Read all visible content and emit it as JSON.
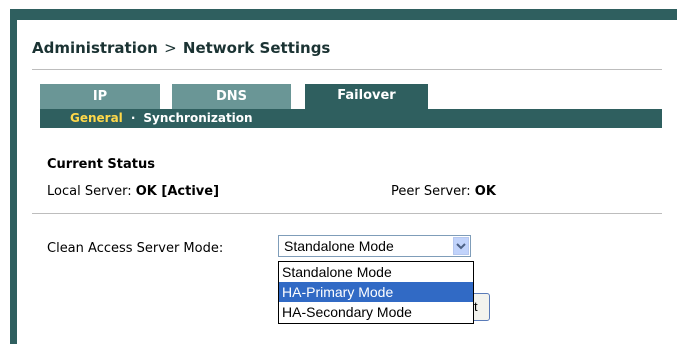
{
  "breadcrumb": {
    "section": "Administration",
    "separator": ">",
    "page": "Network Settings"
  },
  "tabs": [
    {
      "label": "IP",
      "active": false
    },
    {
      "label": "DNS",
      "active": false
    },
    {
      "label": "Failover",
      "active": true
    }
  ],
  "subtabs": {
    "general": "General",
    "dot": "·",
    "sync": "Synchronization"
  },
  "status": {
    "title": "Current Status",
    "local_label": "Local Server:",
    "local_value": "OK [Active]",
    "peer_label": "Peer Server:",
    "peer_value": "OK"
  },
  "mode": {
    "label": "Clean Access Server Mode:",
    "selected": "Standalone Mode",
    "options": [
      "Standalone Mode",
      "HA-Primary Mode",
      "HA-Secondary Mode"
    ],
    "highlighted_option": "HA-Primary Mode"
  },
  "partial_button_text": "t",
  "colors": {
    "frame": "#2f5f5f",
    "tab_inactive": "#6a9696",
    "subtab_active": "#ffd84a",
    "option_highlight": "#316ac5"
  },
  "icons": {
    "dropdown": "chevron-down-icon"
  }
}
